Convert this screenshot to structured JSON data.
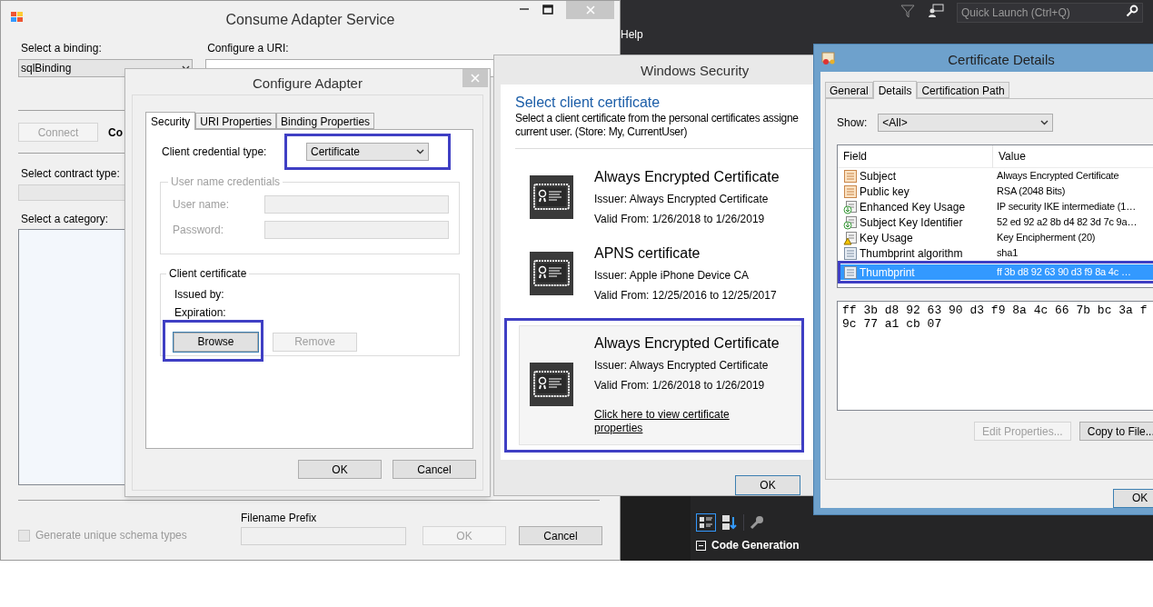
{
  "ide": {
    "menu": [
      {
        "label": "Help"
      }
    ],
    "quick_launch": {
      "placeholder": "Quick Launch (Ctrl+Q)"
    },
    "properties": {
      "category": "Code Generation",
      "expanded": true
    }
  },
  "consume_adapter_service": {
    "title": "Consume Adapter Service",
    "binding": {
      "label": "Select a binding:",
      "value": "sqlBinding"
    },
    "uri": {
      "label": "Configure a URI:"
    },
    "connect_button": {
      "label": "Connect",
      "disabled": true
    },
    "partial_heading": "Co",
    "contract_type": {
      "label": "Select contract type:"
    },
    "category": {
      "label": "Select a category:"
    },
    "unique_schema": {
      "label": "Generate unique schema types",
      "checked": false,
      "disabled": true
    },
    "filename_prefix": {
      "label": "Filename Prefix"
    },
    "buttons": [
      {
        "label": "OK",
        "disabled": true
      },
      {
        "label": "Cancel",
        "disabled": false
      }
    ]
  },
  "configure_adapter": {
    "title": "Configure Adapter",
    "tabs": [
      {
        "label": "Security",
        "selected": true
      },
      {
        "label": "URI Properties",
        "selected": false
      },
      {
        "label": "Binding Properties",
        "selected": false
      }
    ],
    "credential_type": {
      "label": "Client credential type:",
      "value": "Certificate",
      "highlighted": true
    },
    "user_name_group": {
      "title": "User name credentials",
      "disabled": true,
      "fields": [
        {
          "label": "User name:"
        },
        {
          "label": "Password:"
        }
      ]
    },
    "client_certificate_group": {
      "title": "Client certificate",
      "rows": [
        {
          "label": "Issued by:"
        },
        {
          "label": "Expiration:"
        }
      ],
      "buttons": [
        {
          "label": "Browse",
          "disabled": false,
          "highlighted": true
        },
        {
          "label": "Remove",
          "disabled": true,
          "highlighted": false
        }
      ]
    },
    "buttons": [
      {
        "label": "OK"
      },
      {
        "label": "Cancel"
      }
    ]
  },
  "windows_security": {
    "title": "Windows Security",
    "heading": "Select client certificate",
    "description_lines": [
      "Select a client certificate from the personal certificates assigne",
      "current user. (Store: My, CurrentUser)"
    ],
    "certificates": [
      {
        "title": "Always Encrypted Certificate",
        "issuer": "Issuer: Always Encrypted Certificate",
        "valid": "Valid From: 1/26/2018 to 1/26/2019",
        "selected": false,
        "highlighted": false
      },
      {
        "title": "APNS certificate",
        "issuer": "Issuer: Apple iPhone Device CA",
        "valid": "Valid From: 12/25/2016 to 12/25/2017",
        "selected": false,
        "highlighted": false
      },
      {
        "title": "Always Encrypted Certificate",
        "issuer": "Issuer: Always Encrypted Certificate",
        "valid": "Valid From: 1/26/2018 to 1/26/2019",
        "link": "Click here to view certificate properties",
        "selected": true,
        "highlighted": true
      }
    ],
    "buttons": [
      {
        "label": "OK"
      }
    ]
  },
  "certificate_details": {
    "title": "Certificate Details",
    "tabs": [
      {
        "label": "General",
        "selected": false
      },
      {
        "label": "Details",
        "selected": true
      },
      {
        "label": "Certification Path",
        "selected": false
      }
    ],
    "show": {
      "label": "Show:",
      "value": "<All>"
    },
    "columns": [
      "Field",
      "Value"
    ],
    "rows": [
      {
        "field": "Subject",
        "value": "Always Encrypted Certificate",
        "kind": "field",
        "selected": false,
        "highlighted": false
      },
      {
        "field": "Public key",
        "value": "RSA (2048 Bits)",
        "kind": "field",
        "selected": false,
        "highlighted": false
      },
      {
        "field": "Enhanced Key Usage",
        "value": "IP security IKE intermediate (1…",
        "kind": "extension",
        "selected": false,
        "highlighted": false
      },
      {
        "field": "Subject Key Identifier",
        "value": "52 ed 92 a2 8b d4 82 3d 7c 9a…",
        "kind": "extension",
        "selected": false,
        "highlighted": false
      },
      {
        "field": "Key Usage",
        "value": "Key Encipherment (20)",
        "kind": "critical",
        "selected": false,
        "highlighted": false
      },
      {
        "field": "Thumbprint algorithm",
        "value": "sha1",
        "kind": "property",
        "selected": false,
        "highlighted": false
      },
      {
        "field": "Thumbprint",
        "value": "ff 3b d8 92 63 90 d3 f9 8a 4c …",
        "kind": "property",
        "selected": true,
        "highlighted": true
      }
    ],
    "value_lines": [
      "ff 3b d8 92 63 90 d3 f9 8a 4c 66 7b bc 3a f",
      "9c 77 a1 cb 07"
    ],
    "buttons": [
      {
        "label": "Edit Properties...",
        "disabled": true
      },
      {
        "label": "Copy to File...",
        "disabled": false
      }
    ],
    "ok_button": {
      "label": "OK"
    }
  }
}
